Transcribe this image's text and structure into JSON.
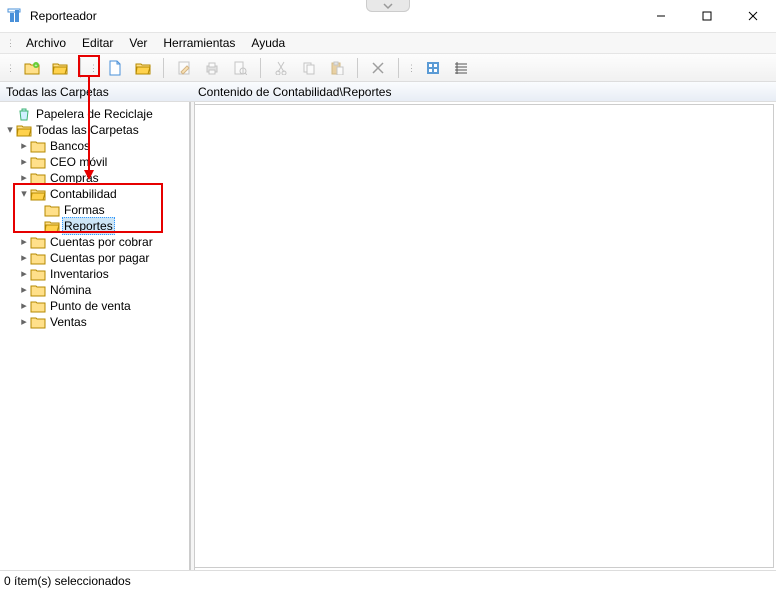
{
  "window": {
    "title": "Reporteador"
  },
  "menu": {
    "archivo": "Archivo",
    "editar": "Editar",
    "ver": "Ver",
    "herramientas": "Herramientas",
    "ayuda": "Ayuda"
  },
  "headers": {
    "left": "Todas las Carpetas",
    "right": "Contenido de Contabilidad\\Reportes"
  },
  "tree": {
    "recycle": "Papelera de Reciclaje",
    "root": "Todas las Carpetas",
    "bancos": "Bancos",
    "ceo": "CEO móvil",
    "compras": "Compras",
    "contabilidad": "Contabilidad",
    "formas": "Formas",
    "reportes": "Reportes",
    "cxc": "Cuentas por cobrar",
    "cxp": "Cuentas por pagar",
    "inventarios": "Inventarios",
    "nomina": "Nómina",
    "pv": "Punto de venta",
    "ventas": "Ventas"
  },
  "status": {
    "text": "0 ítem(s) seleccionados"
  }
}
